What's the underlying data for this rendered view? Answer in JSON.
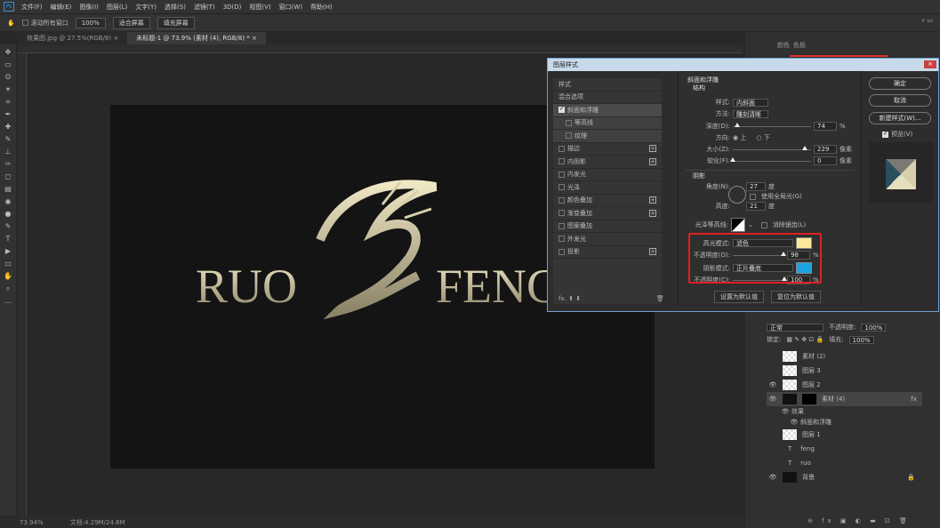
{
  "menu": [
    "文件(F)",
    "编辑(E)",
    "图像(I)",
    "图层(L)",
    "文字(Y)",
    "选择(S)",
    "滤镜(T)",
    "3D(D)",
    "视图(V)",
    "窗口(W)",
    "帮助(H)"
  ],
  "options": {
    "scroll_all": "滚动所有窗口",
    "zoom": "100%",
    "fit": "适合屏幕",
    "fill": "填充屏幕"
  },
  "tabs": [
    {
      "label": "效果图.jpg @ 27.5%(RGB/8) ×"
    },
    {
      "label": "未标题-1 @ 73.9% (素材 (4), RGB/8) * ×"
    }
  ],
  "canvas": {
    "text_left": "RUO",
    "text_right": "FENG"
  },
  "status": {
    "zoom": "73.94%",
    "doc": "文档:4.29M/24.6M"
  },
  "right_panel": {
    "tab_color": "颜色",
    "tab_swatch": "色板"
  },
  "dialog": {
    "title": "图层样式",
    "close": "×",
    "list": [
      {
        "label": "样式",
        "type": "header"
      },
      {
        "label": "混合选项",
        "type": "header"
      },
      {
        "label": "斜面和浮雕",
        "checked": true,
        "selected": true
      },
      {
        "label": "等高线",
        "checked": false,
        "sub": true
      },
      {
        "label": "纹理",
        "checked": false,
        "sub": true
      },
      {
        "label": "描边",
        "checked": false,
        "plus": true
      },
      {
        "label": "内阴影",
        "checked": false,
        "plus": true
      },
      {
        "label": "内发光",
        "checked": false
      },
      {
        "label": "光泽",
        "checked": false
      },
      {
        "label": "颜色叠加",
        "checked": false,
        "plus": true
      },
      {
        "label": "渐变叠加",
        "checked": false,
        "plus": true
      },
      {
        "label": "图案叠加",
        "checked": false
      },
      {
        "label": "外发光",
        "checked": false
      },
      {
        "label": "投影",
        "checked": false,
        "plus": true
      }
    ],
    "fx": "fx.",
    "section": "斜面和浮雕",
    "structure": "结构",
    "style_label": "样式:",
    "style_value": "内斜面",
    "method_label": "方法:",
    "method_value": "雕刻清晰",
    "depth_label": "深度(D):",
    "depth_value": "74",
    "depth_pct": 74,
    "direction_label": "方向:",
    "dir_up": "上",
    "dir_down": "下",
    "size_label": "大小(Z):",
    "size_value": "229",
    "size_pct": 92,
    "px": "像素",
    "soften_label": "软化(F):",
    "soften_value": "0",
    "shading": "阴影",
    "angle_label": "角度(N):",
    "angle_value": "27",
    "deg": "度",
    "global_light": "使用全局光(G)",
    "altitude_label": "高度:",
    "altitude_value": "21",
    "gloss_label": "光泽等高线:",
    "antialias": "消除锯齿(L)",
    "highlight_label": "高光模式:",
    "highlight_value": "滤色",
    "highlight_color": "#fde89a",
    "hl_opacity_label": "不透明度(O):",
    "hl_opacity_value": "98",
    "hl_opacity_pct": 98,
    "shadow_label": "阴影模式:",
    "shadow_value": "正片叠底",
    "shadow_color": "#1aa3e0",
    "sh_opacity_label": "不透明度(C):",
    "sh_opacity_value": "100",
    "sh_opacity_pct": 100,
    "pct": "%",
    "make_default": "设置为默认值",
    "reset_default": "复位为默认值",
    "ok": "确定",
    "cancel": "取消",
    "new_style": "新建样式(W)...",
    "preview": "预览(V)"
  },
  "layers": {
    "blend": "正常",
    "opacity_label": "不透明度:",
    "opacity": "100%",
    "lock": "锁定:",
    "fill_label": "填充:",
    "fill": "100%",
    "items": [
      {
        "name": "素材 (2)",
        "visible": false
      },
      {
        "name": "图层 3",
        "visible": false
      },
      {
        "name": "图层 2",
        "visible": true
      },
      {
        "name": "素材 (4)",
        "visible": true,
        "selected": true,
        "fx": "fx"
      },
      {
        "name": "效果",
        "effect": true
      },
      {
        "name": "斜面和浮雕",
        "effect": true,
        "sub": true
      },
      {
        "name": "图层 1",
        "visible": false
      },
      {
        "name": "feng",
        "visible": false,
        "text": true
      },
      {
        "name": "ruo",
        "visible": false,
        "text": true
      },
      {
        "name": "背景",
        "visible": true,
        "locked": true,
        "dark": true
      }
    ]
  }
}
